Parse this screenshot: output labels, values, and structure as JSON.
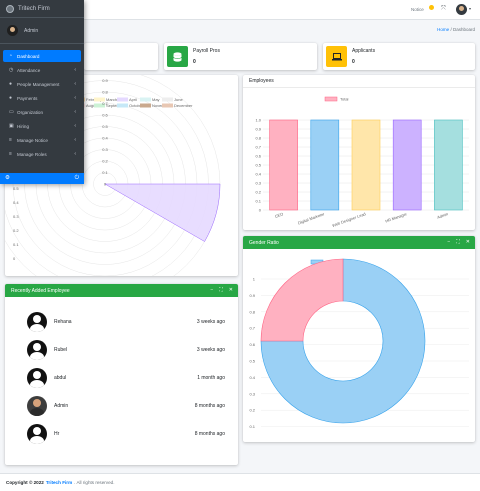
{
  "app": {
    "brand": "Tritech Firm"
  },
  "topbar": {
    "notice_label": "Notice",
    "notice_count": "0"
  },
  "breadcrumb": {
    "home": "Home",
    "separator": "/",
    "current": "Dashboard"
  },
  "sidebar": {
    "user": "Admin",
    "items": [
      {
        "label": "Dashboard",
        "icon": "dashboard-icon",
        "active": true,
        "has_children": false
      },
      {
        "label": "Attendance",
        "icon": "clock-icon",
        "active": false,
        "has_children": true
      },
      {
        "label": "People Management",
        "icon": "user-icon",
        "active": false,
        "has_children": true
      },
      {
        "label": "Payments",
        "icon": "user-icon",
        "active": false,
        "has_children": true
      },
      {
        "label": "Organization",
        "icon": "folder-icon",
        "active": false,
        "has_children": true
      },
      {
        "label": "Hiring",
        "icon": "briefcase-icon",
        "active": false,
        "has_children": true
      },
      {
        "label": "Manage Notice",
        "icon": "list-icon",
        "active": false,
        "has_children": true
      },
      {
        "label": "Manage Roles",
        "icon": "list-icon",
        "active": false,
        "has_children": true
      }
    ]
  },
  "info_boxes": [
    {
      "label": "Payroll Pros",
      "value": "0",
      "color": "#28a745",
      "icon": "database-icon"
    },
    {
      "label": "Applicants",
      "value": "0",
      "color": "#ffc107",
      "icon": "laptop-icon"
    }
  ],
  "cards": {
    "employees_title": "Employees",
    "gender_title": "Gender Ratio",
    "recent_title": "Recently Added Employee"
  },
  "recent_employees": [
    {
      "name": "Rehana",
      "time": "3 weeks ago",
      "photo": false
    },
    {
      "name": "Rubel",
      "time": "3 weeks ago",
      "photo": false
    },
    {
      "name": "abdul",
      "time": "1 month ago",
      "photo": false
    },
    {
      "name": "Admin",
      "time": "8 months ago",
      "photo": true
    },
    {
      "name": "Hr",
      "time": "8 months ago",
      "photo": false
    }
  ],
  "footer": {
    "copyright": "Copyright © 2022",
    "company": "Tritech Firm",
    "rights": ". All rights reserved."
  },
  "chart_data": [
    {
      "type": "polarArea",
      "legend": [
        {
          "name": "January",
          "color": "#ffe0e6"
        },
        {
          "name": "February",
          "color": "#ffe0b2"
        },
        {
          "name": "March",
          "color": "#fff5cc"
        },
        {
          "name": "April",
          "color": "#e5d9ff"
        },
        {
          "name": "May",
          "color": "#d9f3f3"
        },
        {
          "name": "June",
          "color": "#eeeeee"
        },
        {
          "name": "July",
          "color": "#ffffcc"
        },
        {
          "name": "August",
          "color": "#ffe6e6"
        },
        {
          "name": "September",
          "color": "#ccf2d5"
        },
        {
          "name": "October",
          "color": "#c6e8f7"
        },
        {
          "name": "November",
          "color": "#c9a98e"
        },
        {
          "name": "December",
          "color": "#e8c7b3"
        }
      ],
      "ticks": [
        "1.0",
        "0.9",
        "0.8",
        "0.7",
        "0.6",
        "0.5",
        "0.4",
        "0.3",
        "0.2",
        "0.1",
        "0"
      ],
      "max": 1,
      "values": [
        0,
        0,
        0,
        1,
        0,
        0,
        0,
        0,
        0,
        0,
        0,
        0
      ]
    },
    {
      "type": "bar",
      "title": "Employees",
      "legend": [
        "Total"
      ],
      "categories": [
        "CEO",
        "Digital Marketer",
        "Web Designer Lead",
        "HR Manager",
        "Admin"
      ],
      "values": [
        1,
        1,
        1,
        1,
        1
      ],
      "colors": [
        "#ffb1c1",
        "#9ad0f5",
        "#ffe6aa",
        "#ccb2ff",
        "#a5dfdf"
      ],
      "borders": [
        "#ff6384",
        "#36a2eb",
        "#ffcd56",
        "#9966ff",
        "#4bc0c0"
      ],
      "ticks": [
        "1.0",
        "0.9",
        "0.8",
        "0.7",
        "0.6",
        "0.5",
        "0.4",
        "0.3",
        "0.2",
        "0.1",
        "0"
      ],
      "ylim": [
        0,
        1
      ]
    },
    {
      "type": "doughnut",
      "title": "Gender Ratio",
      "legend": [
        {
          "name": "Male",
          "color": "#9ad0f5"
        },
        {
          "name": "Female",
          "color": "#ffb1c1"
        }
      ],
      "values": [
        3,
        1
      ],
      "ticks": [
        "1",
        "0.9",
        "0.8",
        "0.7",
        "0.6",
        "0.5",
        "0.4",
        "0.3",
        "0.2",
        "0.1",
        "0"
      ],
      "ylim": [
        0,
        1
      ]
    }
  ]
}
